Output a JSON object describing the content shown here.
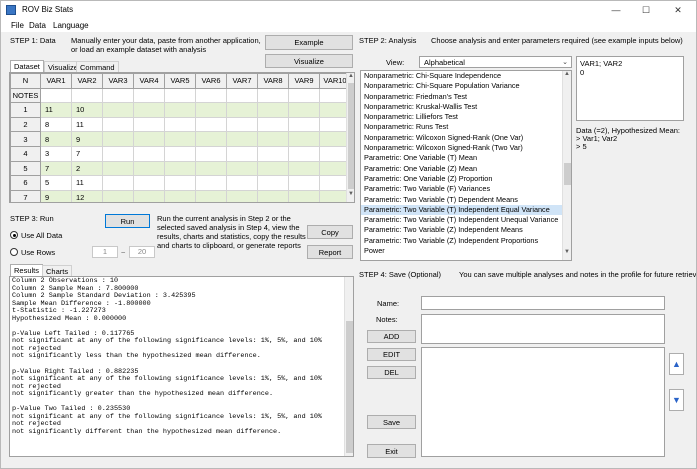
{
  "window": {
    "title": "ROV Biz Stats",
    "minimize": "—",
    "maximize": "☐",
    "close": "✕"
  },
  "menu": {
    "file": "File",
    "data": "Data",
    "language": "Language"
  },
  "step1": {
    "label": "STEP 1: Data",
    "instructions_1": "Manually enter your data, paste from another application,",
    "instructions_2": "or load an example dataset with analysis",
    "example_button": "Example",
    "visualize_button": "Visualize"
  },
  "data_tabs": [
    "Dataset",
    "Visualize",
    "Command"
  ],
  "grid": {
    "corner": "N",
    "columns": [
      "VAR1",
      "VAR2",
      "VAR3",
      "VAR4",
      "VAR5",
      "VAR6",
      "VAR7",
      "VAR8",
      "VAR9",
      "VAR10"
    ],
    "notes_label": "NOTES",
    "rows": [
      {
        "n": "1",
        "v1": "11",
        "v2": "10"
      },
      {
        "n": "2",
        "v1": "8",
        "v2": "11"
      },
      {
        "n": "3",
        "v1": "8",
        "v2": "9"
      },
      {
        "n": "4",
        "v1": "3",
        "v2": "7"
      },
      {
        "n": "5",
        "v1": "7",
        "v2": "2"
      },
      {
        "n": "6",
        "v1": "5",
        "v2": "11"
      },
      {
        "n": "7",
        "v1": "9",
        "v2": "12"
      }
    ]
  },
  "step3": {
    "label": "STEP 3: Run",
    "run_button": "Run",
    "desc_1": "Run the current analysis in Step 2 or the",
    "desc_2": "selected saved analysis in Step 4, view the",
    "desc_3": "results, charts and statistics, copy the results",
    "desc_4": "and charts to clipboard, or generate reports",
    "use_all_data": "Use All Data",
    "use_rows": "Use Rows",
    "row_from": "1",
    "row_sep": "~",
    "row_to": "20",
    "copy_button": "Copy",
    "report_button": "Report"
  },
  "result_tabs": [
    "Results",
    "Charts"
  ],
  "results_lines": [
    "Column 2 Observations : 10",
    "Column 2 Sample Mean : 7.800000",
    "Column 2 Sample Standard Deviation : 3.425395",
    "Sample Mean Difference : -1.800000",
    "t-Statistic : -1.227273",
    "Hypothesized Mean : 0.000000",
    "",
    "p-Value Left Tailed : 0.117765",
    "not significant at any of the following significance levels: 1%, 5%, and 10%",
    "not rejected",
    "not significantly less than the hypothesized mean difference.",
    "",
    "p-Value Right Tailed : 0.882235",
    "not significant at any of the following significance levels: 1%, 5%, and 10%",
    "not rejected",
    "not significantly greater than the hypothesized mean difference.",
    "",
    "p-Value Two Tailed : 0.235530",
    "not significant at any of the following significance levels: 1%, 5%, and 10%",
    "not rejected",
    "not significantly different than the hypothesized mean difference."
  ],
  "step2": {
    "label": "STEP 2: Analysis",
    "instructions": "Choose analysis and enter parameters required (see example inputs below)",
    "view_label": "View:",
    "view_value": "Alphabetical",
    "analyses": [
      "Nonparametric: Chi-Square Independence",
      "Nonparametric: Chi-Square Population Variance",
      "Nonparametric: Friedman's Test",
      "Nonparametric: Kruskal-Wallis Test",
      "Nonparametric: Lilliefors Test",
      "Nonparametric: Runs Test",
      "Nonparametric: Wilcoxon Signed-Rank (One Var)",
      "Nonparametric: Wilcoxon Signed-Rank (Two Var)",
      "Parametric: One Variable (T) Mean",
      "Parametric: One Variable (Z) Mean",
      "Parametric: One Variable (Z) Proportion",
      "Parametric: Two Variable (F) Variances",
      "Parametric: Two Variable (T) Dependent Means",
      "Parametric: Two Variable (T) Independent Equal Variance",
      "Parametric: Two Variable (T) Independent Unequal Variance",
      "Parametric: Two Variable (Z) Independent Means",
      "Parametric: Two Variable (Z) Independent Proportions",
      "Power"
    ],
    "selected_index": 13,
    "param_value_1": "VAR1; VAR2",
    "param_value_2": "0",
    "hint_1": "Data (=2), Hypothesized Mean:",
    "hint_2": ">  Var1; Var2",
    "hint_3": ">  5"
  },
  "step4": {
    "label": "STEP 4: Save (Optional)",
    "instructions": "You can save multiple analyses and notes in the profile for future retrieval",
    "name_label": "Name:",
    "notes_label": "Notes:",
    "add_button": "ADD",
    "edit_button": "EDIT",
    "del_button": "DEL",
    "save_button": "Save",
    "exit_button": "Exit",
    "up_arrow": "▲",
    "down_arrow": "▼"
  },
  "colors": {
    "row_highlight": "#e6f2d6",
    "selection": "#d0e4f7",
    "focus_border": "#0078d7",
    "arrow_blue": "#2a63c8"
  }
}
